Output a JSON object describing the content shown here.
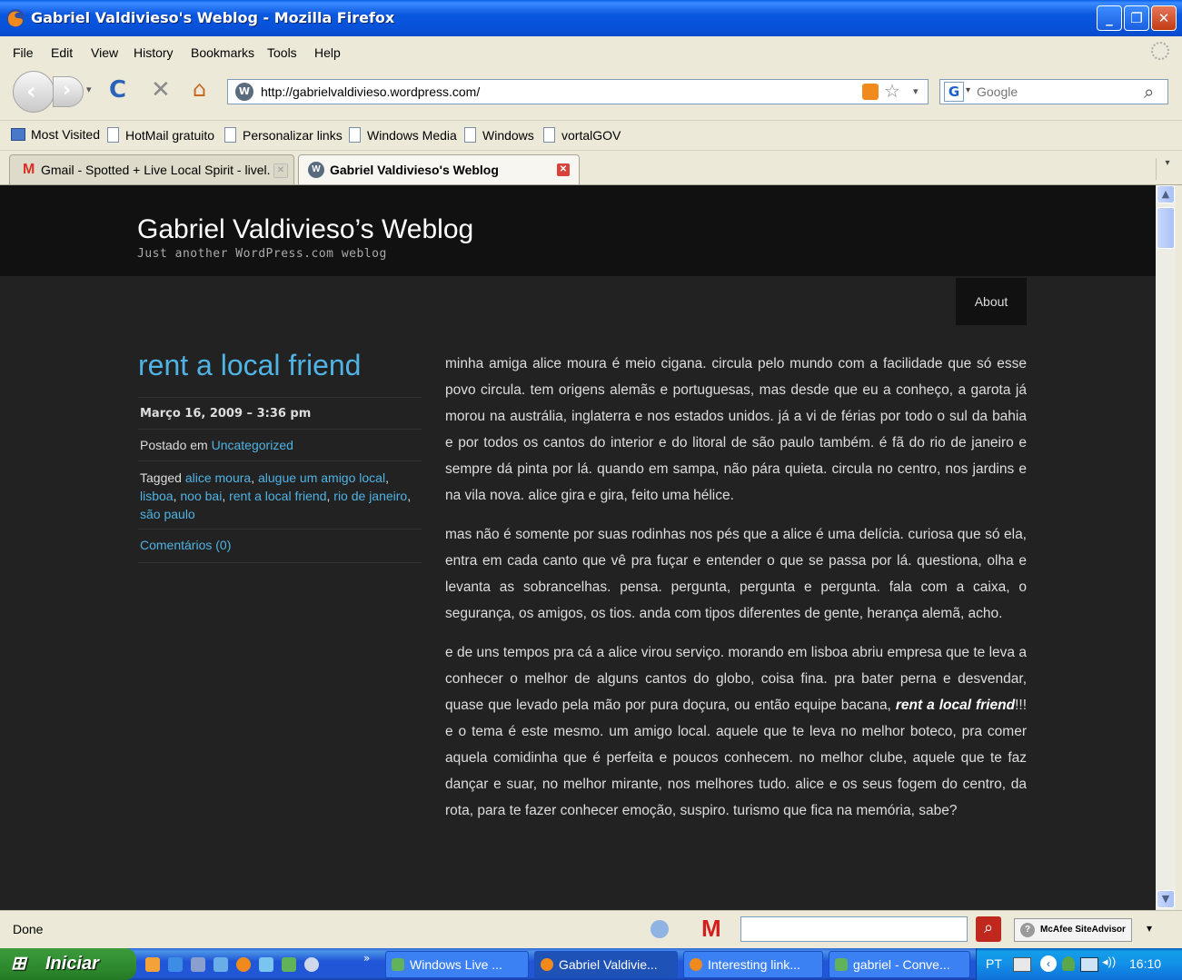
{
  "window": {
    "title": "Gabriel Valdivieso's Weblog - Mozilla Firefox"
  },
  "menu": [
    "File",
    "Edit",
    "View",
    "History",
    "Bookmarks",
    "Tools",
    "Help"
  ],
  "nav": {
    "url": "http://gabrielvaldivieso.wordpress.com/",
    "search_placeholder": "Google"
  },
  "bookmarks": [
    "Most Visited",
    "HotMail gratuito",
    "Personalizar links",
    "Windows Media",
    "Windows",
    "vortalGOV"
  ],
  "tabs": [
    {
      "label": "Gmail - Spotted + Live Local Spirit - livel..."
    },
    {
      "label": "Gabriel Valdivieso's Weblog"
    }
  ],
  "page": {
    "blog_title": "Gabriel Valdivieso’s Weblog",
    "tagline": "Just another WordPress.com weblog",
    "nav_about": "About",
    "post_title": "rent a local friend",
    "date": "Março 16, 2009 – 3:36 pm",
    "posted_in_label": "Postado em",
    "category": "Uncategorized",
    "tagged_label": "Tagged",
    "tags": [
      "alice moura",
      "alugue um amigo local",
      "lisboa",
      "noo bai",
      "rent a local friend",
      "rio de janeiro",
      "são paulo"
    ],
    "comments": "Comentários (0)",
    "paragraphs": [
      "minha amiga alice moura é meio cigana. circula pelo mundo com a facilidade que só esse povo circula. tem origens alemãs e portuguesas, mas desde que eu a conheço, a garota já morou na austrália, inglaterra e nos estados unidos. já a vi de férias por todo o sul da bahia e por todos os cantos do interior e do litoral de são paulo também. é fã do rio de janeiro e sempre dá pinta por lá. quando em sampa, não pára quieta. circula no centro, nos jardins e na vila nova. alice gira e gira, feito uma hélice.",
      "mas não é somente por suas rodinhas nos pés que a alice é uma delícia. curiosa que só ela, entra em cada canto que vê pra fuçar e entender o que se passa por lá. questiona, olha e levanta as sobrancelhas. pensa. pergunta, pergunta e pergunta. fala com a caixa, o segurança, os amigos, os tios. anda com tipos diferentes de gente, herança alemã, acho."
    ],
    "p3_before": "e de uns tempos pra cá a alice virou serviço. morando em lisboa abriu empresa que te leva a conhecer o melhor de alguns cantos do globo, coisa fina. pra bater perna e desvendar, quase que levado pela mão por pura doçura, ou então equipe bacana,",
    "p3_em": "rent a local friend",
    "p3_after": "!!! e o tema é este mesmo. um amigo local. aquele que te leva no melhor boteco, pra comer aquela comidinha que é perfeita e poucos conhecem. no melhor clube, aquele que te faz dançar e suar, no melhor mirante, nos melhores tudo. alice e os seus fogem do centro, da rota, para te fazer conhecer emoção, suspiro. turismo que fica na memória, sabe?"
  },
  "status": {
    "text": "Done",
    "siteadvisor": "McAfee SiteAdvisor"
  },
  "taskbar": {
    "start": "Iniciar",
    "items": [
      "Windows Live ...",
      "Gabriel Valdivie...",
      "Interesting link...",
      "gabriel - Conve..."
    ],
    "lang": "PT",
    "clock": "16:10"
  },
  "colors": {
    "link": "#4fb3e4",
    "page_bg": "#222222",
    "header_bg": "#111111"
  }
}
